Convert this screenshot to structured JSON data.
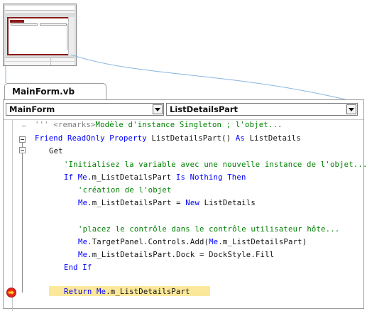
{
  "tab": {
    "label": "MainForm.vb"
  },
  "combos": {
    "left": "MainForm",
    "right": "ListDetailsPart"
  },
  "code": {
    "l1_pre": "''' ",
    "l1_tag": "<remarks>",
    "l1_text": "Modèle d'instance Singleton ; l'objet...",
    "l2_kw1": "Friend ReadOnly Property ",
    "l2_id1": "ListDetailsPart() ",
    "l2_kw2": "As ",
    "l2_id2": "ListDetails",
    "l3": "Get",
    "l4": "'Initialisez la variable avec une nouvelle instance de l'objet...",
    "l5_kw1": "If ",
    "l5_kw2": "Me",
    "l5_id1": ".m_ListDetailsPart ",
    "l5_kw3": "Is Nothing Then",
    "l6": "'création de l'objet",
    "l7_kw1": "Me",
    "l7_id1": ".m_ListDetailsPart = ",
    "l7_kw2": "New ",
    "l7_id2": "ListDetails",
    "l8": "'placez le contrôle dans le contrôle utilisateur hôte...",
    "l9_kw1": "Me",
    "l9_id1": ".TargetPanel.Controls.Add(",
    "l9_kw2": "Me",
    "l9_id2": ".m_ListDetailsPart)",
    "l10_kw1": "Me",
    "l10_id1": ".m_ListDetailsPart.Dock = DockStyle.Fill",
    "l11": "End If",
    "l12_kw1": "Return ",
    "l12_kw2": "Me",
    "l12_id1": ".m_ListDetailsPart"
  },
  "colors": {
    "keyword": "#0000ff",
    "comment": "#008000",
    "highlight": "#fbe89a",
    "thumbnail_frame": "#8b1a1a"
  },
  "icons": [
    "breakpoint-arrow-icon",
    "collapse-icon",
    "dropdown-arrow-icon"
  ]
}
